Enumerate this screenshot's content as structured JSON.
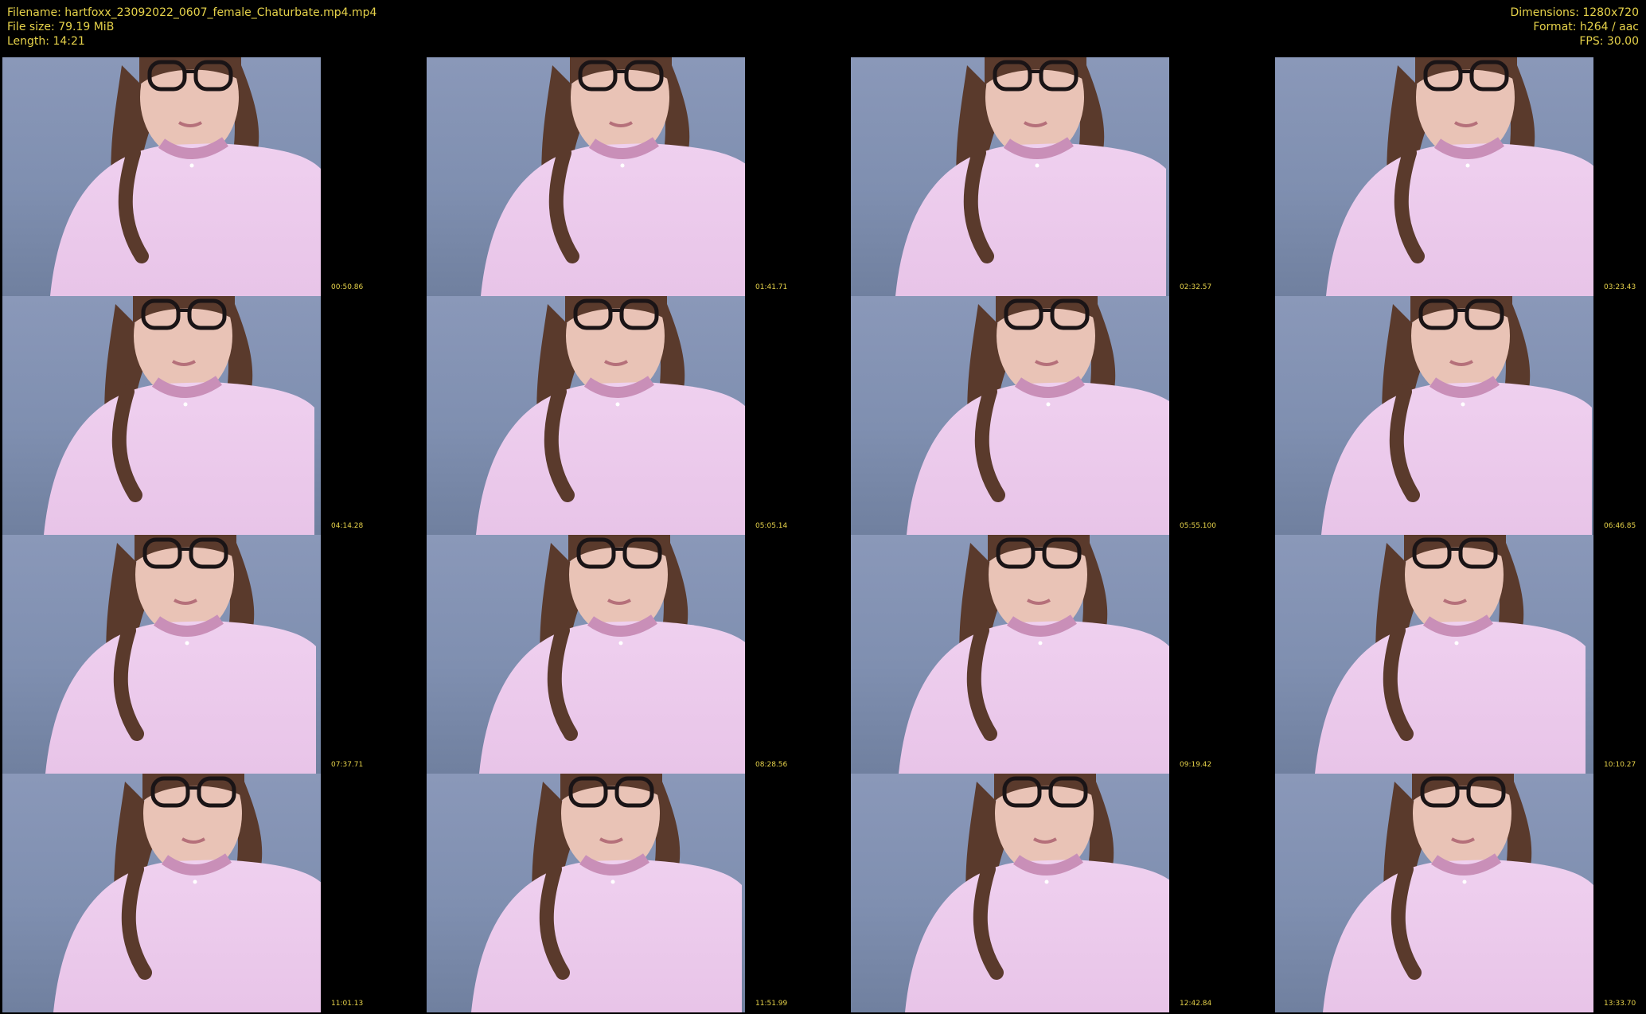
{
  "header": {
    "filename": "Filename: hartfoxx_23092022_0607_female_Chaturbate.mp4.mp4",
    "file_size": "File size: 79.19 MiB",
    "length": "Length: 14:21",
    "dimensions": "Dimensions: 1280x720",
    "format": "Format: h264 / aac",
    "fps": "FPS: 30.00"
  },
  "colors": {
    "text": "#e6d24a",
    "background": "#000000",
    "wall": "#8292b3",
    "sweater": "#e8c4e8",
    "hair": "#5a3a2c"
  },
  "thumbnails": [
    {
      "timestamp": "00:50.86"
    },
    {
      "timestamp": "01:41.71"
    },
    {
      "timestamp": "02:32.57"
    },
    {
      "timestamp": "03:23.43"
    },
    {
      "timestamp": "04:14.28"
    },
    {
      "timestamp": "05:05.14"
    },
    {
      "timestamp": "05:55.100"
    },
    {
      "timestamp": "06:46.85"
    },
    {
      "timestamp": "07:37.71"
    },
    {
      "timestamp": "08:28.56"
    },
    {
      "timestamp": "09:19.42"
    },
    {
      "timestamp": "10:10.27"
    },
    {
      "timestamp": "11:01.13"
    },
    {
      "timestamp": "11:51.99"
    },
    {
      "timestamp": "12:42.84"
    },
    {
      "timestamp": "13:33.70"
    }
  ]
}
